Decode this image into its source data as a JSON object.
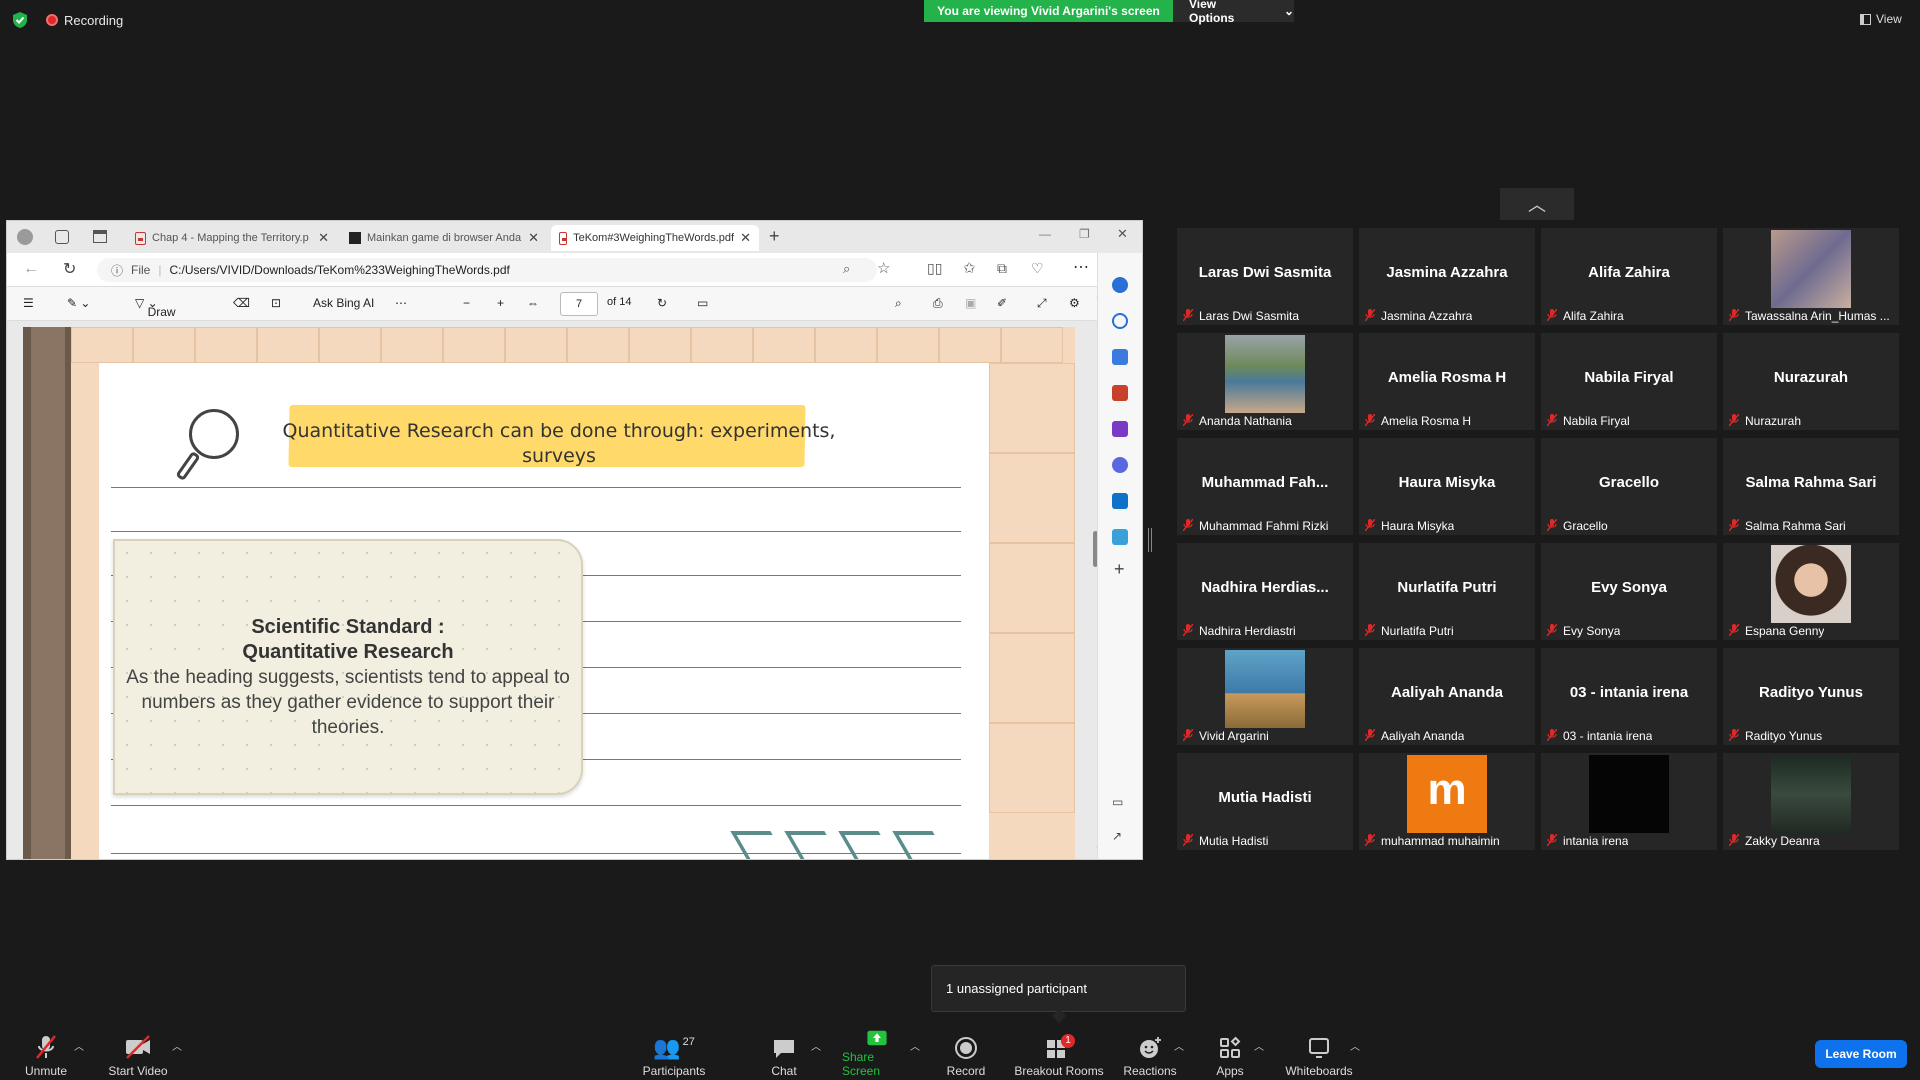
{
  "topbar": {
    "recording_label": "Recording",
    "viewing_banner": "You are viewing Vivid Argarini's screen",
    "view_options_label": "View Options",
    "view_label": "View"
  },
  "browser": {
    "tabs": [
      {
        "title": "Chap 4 - Mapping the Territory.p",
        "icon": "pdf-icon"
      },
      {
        "title": "Mainkan game di browser Anda",
        "icon": "game-icon"
      },
      {
        "title": "TeKom#3WeighingTheWords.pdf",
        "icon": "pdf-icon"
      }
    ],
    "address_prefix": "File",
    "address": "C:/Users/VIVID/Downloads/TeKom%233WeighingTheWords.pdf",
    "pdf_toolbar": {
      "draw_label": "Draw",
      "ask_bing_label": "Ask Bing AI",
      "page_current": "7",
      "page_total": "of 14"
    }
  },
  "slide": {
    "heading": "Quantitative Research can be done through: experiments, surveys",
    "card_title_1": "Scientific Standard :",
    "card_title_2": "Quantitative Research",
    "card_body": "As the heading suggests, scientists tend to appeal to numbers as they gather evidence to support their theories."
  },
  "participants": [
    {
      "name": "Laras Dwi Sasmita",
      "label": "Laras Dwi Sasmita",
      "video": "none"
    },
    {
      "name": "Jasmina Azzahra",
      "label": "Jasmina Azzahra",
      "video": "none"
    },
    {
      "name": "Alifa Zahira",
      "label": "Alifa Zahira",
      "video": "none"
    },
    {
      "name": "",
      "label": "Tawassalna Arin_Humas ...",
      "video": "blurred"
    },
    {
      "name": "",
      "label": "Ananda Nathania",
      "video": "tennis"
    },
    {
      "name": "Amelia Rosma H",
      "label": "Amelia Rosma H",
      "video": "none"
    },
    {
      "name": "Nabila Firyal",
      "label": "Nabila Firyal",
      "video": "none"
    },
    {
      "name": "Nurazurah",
      "label": "Nurazurah",
      "video": "none"
    },
    {
      "name": "Muhammad  Fah...",
      "label": "Muhammad Fahmi Rizki",
      "video": "none"
    },
    {
      "name": "Haura Misyka",
      "label": "Haura Misyka",
      "video": "none"
    },
    {
      "name": "Gracello",
      "label": "Gracello",
      "video": "none"
    },
    {
      "name": "Salma Rahma Sari",
      "label": "Salma Rahma Sari",
      "video": "none"
    },
    {
      "name": "Nadhira  Herdias...",
      "label": "Nadhira Herdiastri",
      "video": "none"
    },
    {
      "name": "Nurlatifa Putri",
      "label": "Nurlatifa Putri",
      "video": "none"
    },
    {
      "name": "Evy Sonya",
      "label": "Evy Sonya",
      "video": "none"
    },
    {
      "name": "",
      "label": "Espana Genny",
      "video": "portrait"
    },
    {
      "name": "",
      "label": "Vivid Argarini",
      "video": "stage"
    },
    {
      "name": "Aaliyah Ananda",
      "label": "Aaliyah Ananda",
      "video": "none"
    },
    {
      "name": "03 - intania irena",
      "label": "03 - intania irena",
      "video": "none"
    },
    {
      "name": "Radityo Yunus",
      "label": "Radityo Yunus",
      "video": "none"
    },
    {
      "name": "Mutia Hadisti",
      "label": "Mutia Hadisti",
      "video": "none"
    },
    {
      "name": "",
      "label": "muhammad muhaimin",
      "video": "letter",
      "letter": "m"
    },
    {
      "name": "",
      "label": "intania irena",
      "video": "black"
    },
    {
      "name": "",
      "label": "Zakky Deanra",
      "video": "dark"
    }
  ],
  "tooltip": {
    "unassigned": "1 unassigned participant"
  },
  "toolbar": {
    "unmute": "Unmute",
    "start_video": "Start Video",
    "participants": "Participants",
    "participants_count": "27",
    "chat": "Chat",
    "share_screen": "Share Screen",
    "record": "Record",
    "breakout_rooms": "Breakout Rooms",
    "breakout_badge": "1",
    "reactions": "Reactions",
    "apps": "Apps",
    "whiteboards": "Whiteboards",
    "leave_room": "Leave Room"
  },
  "colors": {
    "banner_green": "#24b24a",
    "share_green": "#24c23e",
    "leave_blue": "#0e72ed",
    "highlight_yellow": "#ffd96a",
    "muted_red": "#e02828"
  }
}
